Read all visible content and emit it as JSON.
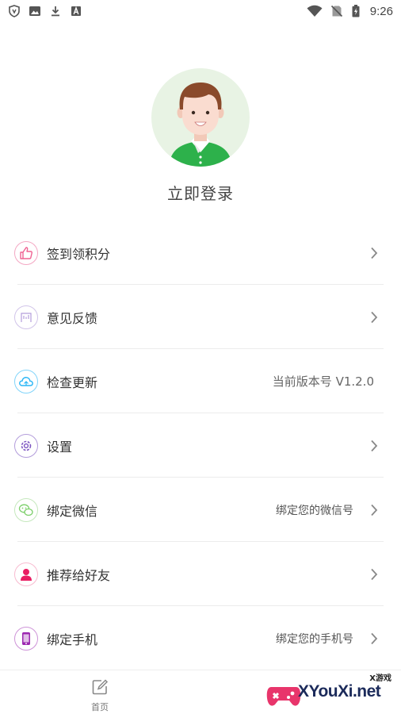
{
  "status_bar": {
    "time": "9:26",
    "icons_left": [
      "shield-icon",
      "image-icon",
      "download-icon",
      "font-icon"
    ],
    "icons_right": [
      "wifi-icon",
      "no-sim-icon",
      "battery-charging-icon"
    ]
  },
  "profile": {
    "login_label": "立即登录"
  },
  "menu": [
    {
      "label": "签到领积分",
      "icon": "thumbs-up-icon",
      "color": "#f06292",
      "value": ""
    },
    {
      "label": "意见反馈",
      "icon": "feedback-icon",
      "color": "#b39ddb",
      "value": ""
    },
    {
      "label": "检查更新",
      "icon": "cloud-update-icon",
      "color": "#29b6f6",
      "value": "当前版本号 V1.2.0"
    },
    {
      "label": "设置",
      "icon": "gear-icon",
      "color": "#7e57c2",
      "value": ""
    },
    {
      "label": "绑定微信",
      "icon": "wechat-icon",
      "color": "#7ccf6a",
      "value": "绑定您的微信号"
    },
    {
      "label": "推荐给好友",
      "icon": "person-icon",
      "color": "#e91e63",
      "value": ""
    },
    {
      "label": "绑定手机",
      "icon": "phone-icon",
      "color": "#9c27b0",
      "value": "绑定您的手机号"
    }
  ],
  "tab_bar": {
    "home_label": "首页"
  },
  "watermark": {
    "brand": "XYouXi.net",
    "tag": "X游戏"
  }
}
